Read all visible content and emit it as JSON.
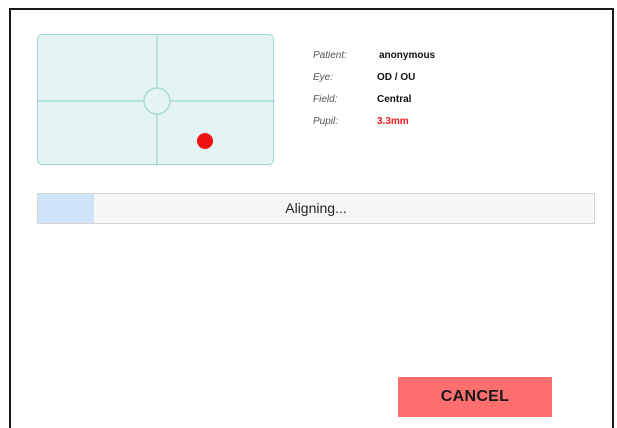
{
  "patient_info": {
    "patient_label": "Patient:",
    "patient_value": "anonymous",
    "eye_label": "Eye:",
    "eye_value": "OD / OU",
    "field_label": "Field:",
    "field_value": "Central",
    "pupil_label": "Pupil:",
    "pupil_value": "3.3mm"
  },
  "progress": {
    "status_text": "Aligning...",
    "fraction": 0.1
  },
  "actions": {
    "cancel_label": "CANCEL"
  },
  "colors": {
    "pupil_marker": "#ee1111",
    "pupil_value_text": "#ee1c1c",
    "progress_fill": "#cfe4f8",
    "cancel_button": "#ff6f6f",
    "panel_background": "#e3f4f3",
    "crosshair": "#9fd6d1"
  },
  "icons": {
    "pupil_marker": "red-dot-icon",
    "target_ring": "circle-icon"
  }
}
